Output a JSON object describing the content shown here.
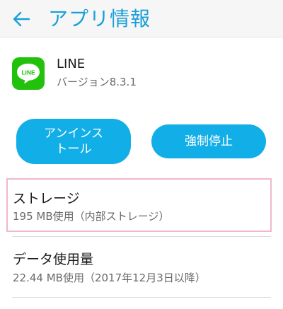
{
  "header": {
    "title": "アプリ情報",
    "back_icon": "arrow-left-icon",
    "accent_color": "#1a9fd8"
  },
  "app": {
    "name": "LINE",
    "version": "バージョン8.3.1",
    "icon": "line-app-icon",
    "icon_text": "LINE",
    "icon_color": "#22c20c"
  },
  "actions": {
    "uninstall_label": "アンインストール",
    "force_stop_label": "強制停止",
    "button_color": "#12aee8"
  },
  "storage": {
    "title": "ストレージ",
    "summary": "195 MB使用（内部ストレージ）"
  },
  "data_usage": {
    "title": "データ使用量",
    "summary": "22.44 MB使用（2017年12月3日以降）"
  }
}
